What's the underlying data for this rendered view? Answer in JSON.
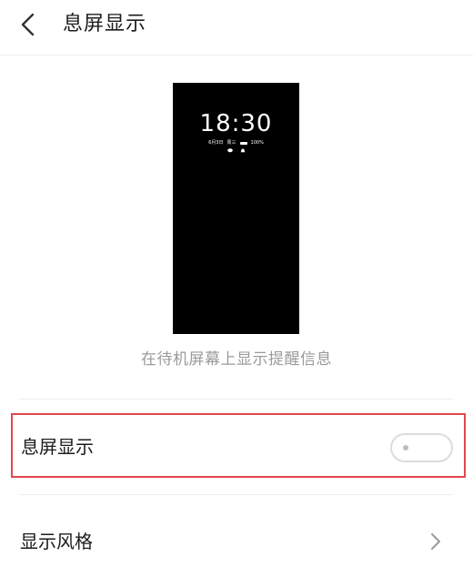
{
  "header": {
    "title": "息屏显示",
    "back_icon": "back-arrow-icon"
  },
  "preview": {
    "time": "18:30",
    "date": "6月3日",
    "weekday": "周三",
    "battery": "100%",
    "caption": "在待机屏幕上显示提醒信息"
  },
  "settings": {
    "aod": {
      "label": "息屏显示",
      "enabled": false
    },
    "style": {
      "label": "显示风格",
      "chevron_icon": "chevron-right-icon"
    }
  },
  "colors": {
    "highlight_border": "#e2474e",
    "preview_background": "#000000",
    "caption_text": "#9a9a9a"
  }
}
